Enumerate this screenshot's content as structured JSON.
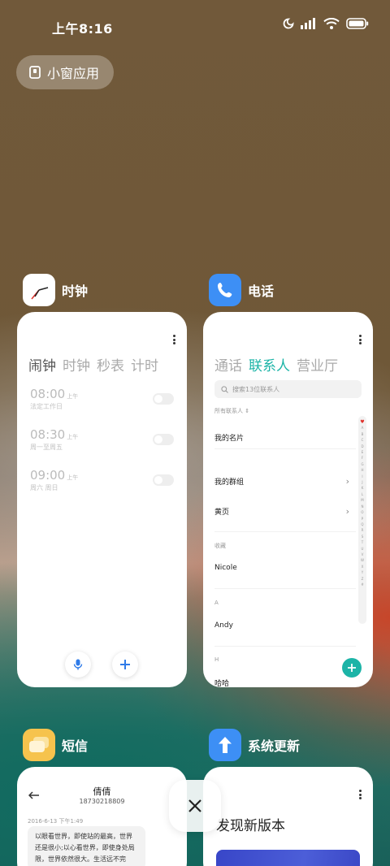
{
  "status_bar": {
    "time": "上午8:16"
  },
  "small_window": {
    "label": "小窗应用"
  },
  "apps": {
    "clock": {
      "name": "时钟",
      "tabs": [
        "闹钟",
        "时钟",
        "秒表",
        "计时"
      ],
      "alarms": [
        {
          "time": "08:00",
          "ampm": "上午",
          "repeat": "法定工作日"
        },
        {
          "time": "08:30",
          "ampm": "上午",
          "repeat": "周一至周五"
        },
        {
          "time": "09:00",
          "ampm": "上午",
          "repeat": "周六 周日"
        }
      ]
    },
    "phone": {
      "name": "电话",
      "tabs": [
        "通话",
        "联系人",
        "营业厅"
      ],
      "search_placeholder": "搜索13位联系人",
      "filter": "所有联系人",
      "my_card": "我的名片",
      "my_groups": "我的群组",
      "yellow_pages": "黄页",
      "favorites_label": "收藏",
      "favorite_contact": "Nicole",
      "section_a": "A",
      "contact_a": "Andy",
      "section_h": "H",
      "contact_h": "哈哈",
      "index_letters": [
        "A",
        "B",
        "C",
        "D",
        "E",
        "F",
        "G",
        "H",
        "I",
        "J",
        "K",
        "L",
        "M",
        "N",
        "O",
        "P",
        "Q",
        "R",
        "S",
        "T",
        "U",
        "V",
        "W",
        "X",
        "Y",
        "Z",
        "#"
      ]
    },
    "sms": {
      "name": "短信",
      "contact_name": "倩倩",
      "contact_number": "18730218809",
      "timestamp": "2016-6-13 下午1:49",
      "message": "以眼看世界，即使站的最高，世界还是很小;以心看世界，即使身处局限，世界依然很大。生活远不完"
    },
    "update": {
      "name": "系统更新",
      "title": "发现新版本"
    }
  },
  "colors": {
    "accent_teal": "#1cb4a7",
    "phone_icon_blue": "#3d8ff5",
    "sms_icon_yellow": "#f6c34d"
  }
}
